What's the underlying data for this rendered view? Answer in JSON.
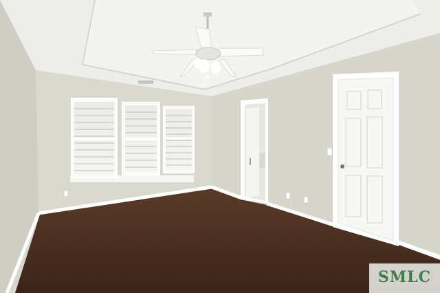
{
  "scene": {
    "description_type": "photo",
    "colors": {
      "ceiling": "#efefec",
      "wall_left": "#d1d0c7",
      "wall_back": "#dddcd3",
      "wall_right": "#d9d8cf",
      "trim": "#ffffff",
      "floor_dark": "#3a2418",
      "floor_mid": "#5a3a29"
    }
  },
  "watermark": {
    "text": "SMLC",
    "color": "#3f7d4b"
  }
}
